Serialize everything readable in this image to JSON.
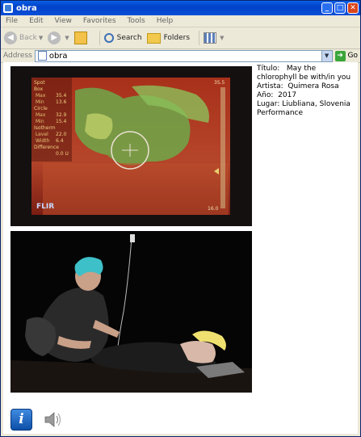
{
  "window": {
    "title": "obra"
  },
  "menu": [
    "File",
    "Edit",
    "View",
    "Favorites",
    "Tools",
    "Help"
  ],
  "toolbar": {
    "back": "Back",
    "search": "Search",
    "folders": "Folders"
  },
  "address": {
    "label": "Address",
    "value": "obra",
    "go": "Go"
  },
  "artwork": {
    "titulo_label": "Título:",
    "titulo_value": "May the chlorophyll be with/in you",
    "artista_label": "Artista:",
    "artista_value": "Quimera Rosa",
    "ano_label": "Año:",
    "ano_value": "2017",
    "lugar_label": "Lugar:",
    "lugar_value": "Liubliana, Slovenia",
    "tipo": "Performance"
  },
  "thermal_readout": {
    "spot": "Spot",
    "box": "Box",
    "max": "Max",
    "min": "Min",
    "circle": "Circle",
    "isotherm": "Isotherm",
    "level": "Level",
    "width": "Width",
    "difference": "Difference",
    "box_max": "35.4",
    "box_min": "13.6",
    "circle_max": "32.9",
    "circle_min": "15.4",
    "level_v": "22.0",
    "width_v": "6.4",
    "diff_v": "0.0 U",
    "scale_top": "35.5",
    "scale_bot": "16.0",
    "brand": "FLIR"
  }
}
